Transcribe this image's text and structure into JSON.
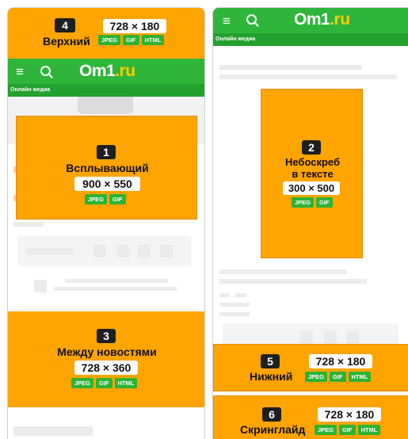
{
  "left_phone": {
    "top_banner": {
      "number": "4",
      "title": "Верхний",
      "size": "728 × 180",
      "formats": [
        "JPEG",
        "GIF",
        "HTML"
      ]
    },
    "appbar": {
      "menu_icon": "≡",
      "logo_main": "Om1",
      "logo_suffix": ".ru",
      "subtitle": "Онлайн медиа"
    },
    "popup_banner": {
      "number": "1",
      "title": "Всплывающий",
      "size": "900 × 550",
      "formats": [
        "JPEG",
        "GIF"
      ]
    },
    "news_banner": {
      "number": "3",
      "title": "Между новостями",
      "size": "728 × 360",
      "formats": [
        "JPEG",
        "GIF",
        "HTML"
      ]
    }
  },
  "right_phone": {
    "appbar": {
      "menu_icon": "≡",
      "logo_main": "Om1",
      "logo_suffix": ".ru",
      "subtitle": "Онлайн медиа"
    },
    "skyscraper_banner": {
      "number": "2",
      "title_line1": "Небоскреб",
      "title_line2": "в тексте",
      "size": "300 × 500",
      "formats": [
        "JPEG",
        "GIF"
      ]
    },
    "bottom_banner": {
      "number": "5",
      "title": "Нижний",
      "size": "728 × 180",
      "formats": [
        "JPEG",
        "GIF",
        "HTML"
      ]
    },
    "screenglide_banner": {
      "number": "6",
      "title": "Скринглайд",
      "size": "728 × 180",
      "formats": [
        "JPEG",
        "GIF",
        "HTML"
      ]
    }
  },
  "colors": {
    "banner": "#ffa400",
    "brand_green": "#2fb53a",
    "format_badge": "#2db334",
    "logo_accent": "#ffcc00"
  }
}
